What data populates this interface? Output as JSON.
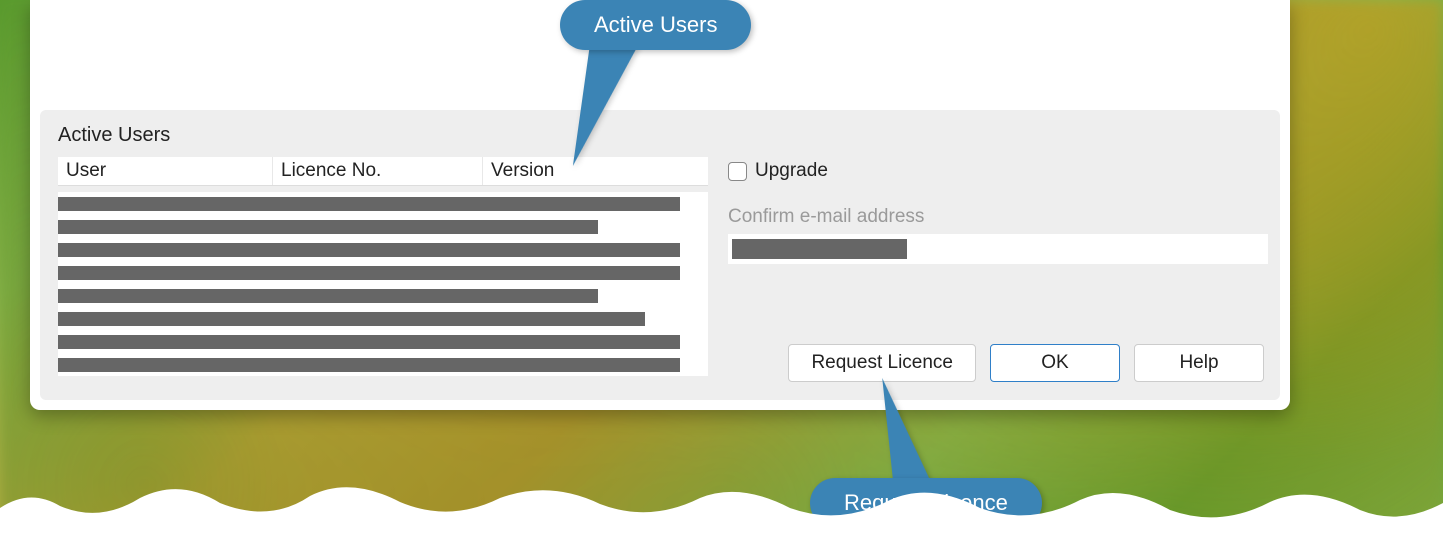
{
  "section": {
    "title": "Active Users"
  },
  "table": {
    "columns": {
      "user": "User",
      "licence": "Licence No.",
      "version": "Version"
    },
    "rows": [
      {
        "redacted_width": 622
      },
      {
        "redacted_width": 540
      },
      {
        "redacted_width": 622
      },
      {
        "redacted_width": 622
      },
      {
        "redacted_width": 540
      },
      {
        "redacted_width": 587
      },
      {
        "redacted_width": 622
      },
      {
        "redacted_width": 622
      }
    ]
  },
  "form": {
    "upgrade_label": "Upgrade",
    "upgrade_checked": false,
    "confirm_email_label": "Confirm e-mail address",
    "email_value_redacted": true
  },
  "buttons": {
    "request": "Request Licence",
    "ok": "OK",
    "help": "Help"
  },
  "callouts": {
    "active_users": "Active Users",
    "request_licence": "Request Licence"
  }
}
